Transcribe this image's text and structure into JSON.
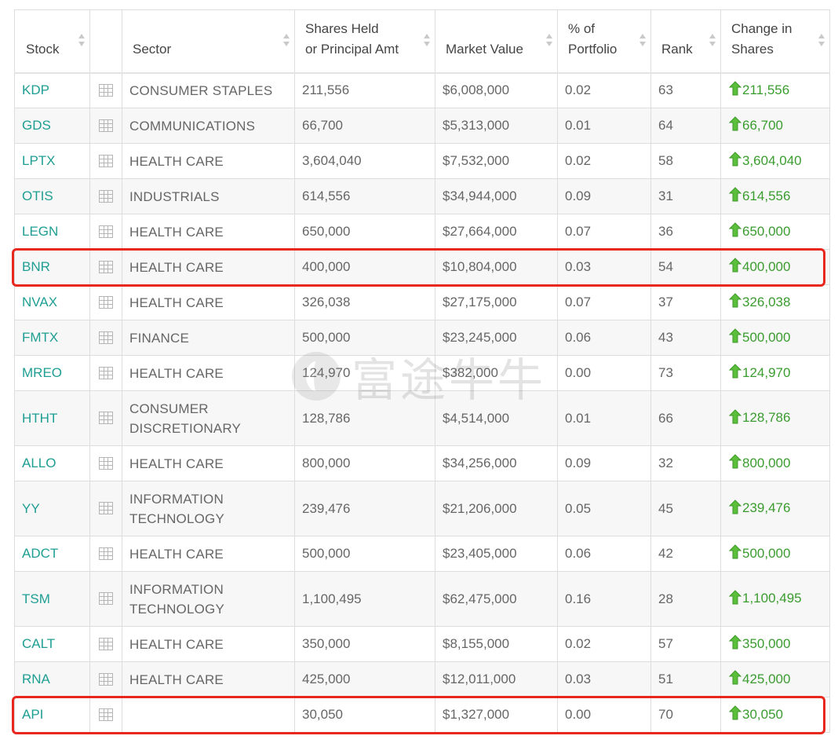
{
  "table": {
    "columns": [
      "Stock",
      "",
      "Sector",
      "Shares Held or Principal Amt",
      "Market Value",
      "% of Portfolio",
      "Rank",
      "Change in Shares"
    ],
    "header_lines": {
      "stock": "Stock",
      "sector": "Sector",
      "shares_1": "Shares Held",
      "shares_2": "or Principal Amt",
      "market": "Market Value",
      "pct_1": "% of",
      "pct_2": "Portfolio",
      "rank": "Rank",
      "change_1": "Change in",
      "change_2": "Shares"
    },
    "rows": [
      {
        "stock": "KDP",
        "sector_1": "CONSUMER STAPLES",
        "sector_2": "",
        "shares": "211,556",
        "market": "$6,008,000",
        "pct": "0.02",
        "rank": "63",
        "change": "211,556"
      },
      {
        "stock": "GDS",
        "sector_1": "COMMUNICATIONS",
        "sector_2": "",
        "shares": "66,700",
        "market": "$5,313,000",
        "pct": "0.01",
        "rank": "64",
        "change": "66,700"
      },
      {
        "stock": "LPTX",
        "sector_1": "HEALTH CARE",
        "sector_2": "",
        "shares": "3,604,040",
        "market": "$7,532,000",
        "pct": "0.02",
        "rank": "58",
        "change": "3,604,040"
      },
      {
        "stock": "OTIS",
        "sector_1": "INDUSTRIALS",
        "sector_2": "",
        "shares": "614,556",
        "market": "$34,944,000",
        "pct": "0.09",
        "rank": "31",
        "change": "614,556"
      },
      {
        "stock": "LEGN",
        "sector_1": "HEALTH CARE",
        "sector_2": "",
        "shares": "650,000",
        "market": "$27,664,000",
        "pct": "0.07",
        "rank": "36",
        "change": "650,000"
      },
      {
        "stock": "BNR",
        "sector_1": "HEALTH CARE",
        "sector_2": "",
        "shares": "400,000",
        "market": "$10,804,000",
        "pct": "0.03",
        "rank": "54",
        "change": "400,000"
      },
      {
        "stock": "NVAX",
        "sector_1": "HEALTH CARE",
        "sector_2": "",
        "shares": "326,038",
        "market": "$27,175,000",
        "pct": "0.07",
        "rank": "37",
        "change": "326,038"
      },
      {
        "stock": "FMTX",
        "sector_1": "FINANCE",
        "sector_2": "",
        "shares": "500,000",
        "market": "$23,245,000",
        "pct": "0.06",
        "rank": "43",
        "change": "500,000"
      },
      {
        "stock": "MREO",
        "sector_1": "HEALTH CARE",
        "sector_2": "",
        "shares": "124,970",
        "market": "$382,000",
        "pct": "0.00",
        "rank": "73",
        "change": "124,970"
      },
      {
        "stock": "HTHT",
        "sector_1": "CONSUMER",
        "sector_2": "DISCRETIONARY",
        "shares": "128,786",
        "market": "$4,514,000",
        "pct": "0.01",
        "rank": "66",
        "change": "128,786"
      },
      {
        "stock": "ALLO",
        "sector_1": "HEALTH CARE",
        "sector_2": "",
        "shares": "800,000",
        "market": "$34,256,000",
        "pct": "0.09",
        "rank": "32",
        "change": "800,000"
      },
      {
        "stock": "YY",
        "sector_1": "INFORMATION",
        "sector_2": "TECHNOLOGY",
        "shares": "239,476",
        "market": "$21,206,000",
        "pct": "0.05",
        "rank": "45",
        "change": "239,476"
      },
      {
        "stock": "ADCT",
        "sector_1": "HEALTH CARE",
        "sector_2": "",
        "shares": "500,000",
        "market": "$23,405,000",
        "pct": "0.06",
        "rank": "42",
        "change": "500,000"
      },
      {
        "stock": "TSM",
        "sector_1": "INFORMATION",
        "sector_2": "TECHNOLOGY",
        "shares": "1,100,495",
        "market": "$62,475,000",
        "pct": "0.16",
        "rank": "28",
        "change": "1,100,495"
      },
      {
        "stock": "CALT",
        "sector_1": "HEALTH CARE",
        "sector_2": "",
        "shares": "350,000",
        "market": "$8,155,000",
        "pct": "0.02",
        "rank": "57",
        "change": "350,000"
      },
      {
        "stock": "RNA",
        "sector_1": "HEALTH CARE",
        "sector_2": "",
        "shares": "425,000",
        "market": "$12,011,000",
        "pct": "0.03",
        "rank": "51",
        "change": "425,000"
      },
      {
        "stock": "API",
        "sector_1": "",
        "sector_2": "",
        "shares": "30,050",
        "market": "$1,327,000",
        "pct": "0.00",
        "rank": "70",
        "change": "30,050"
      }
    ]
  },
  "highlighted_rows": [
    "BNR",
    "API"
  ],
  "watermark": "富途牛牛",
  "colors": {
    "ticker": "#1f9e93",
    "change": "#3a9c2f",
    "highlight": "#e8271f",
    "border": "#dddddd",
    "row_alt": "#f7f7f7"
  },
  "icons": {
    "row_chart": "grid-table-icon",
    "change_up": "up-arrow-icon",
    "sort": "sort-arrows-icon"
  }
}
